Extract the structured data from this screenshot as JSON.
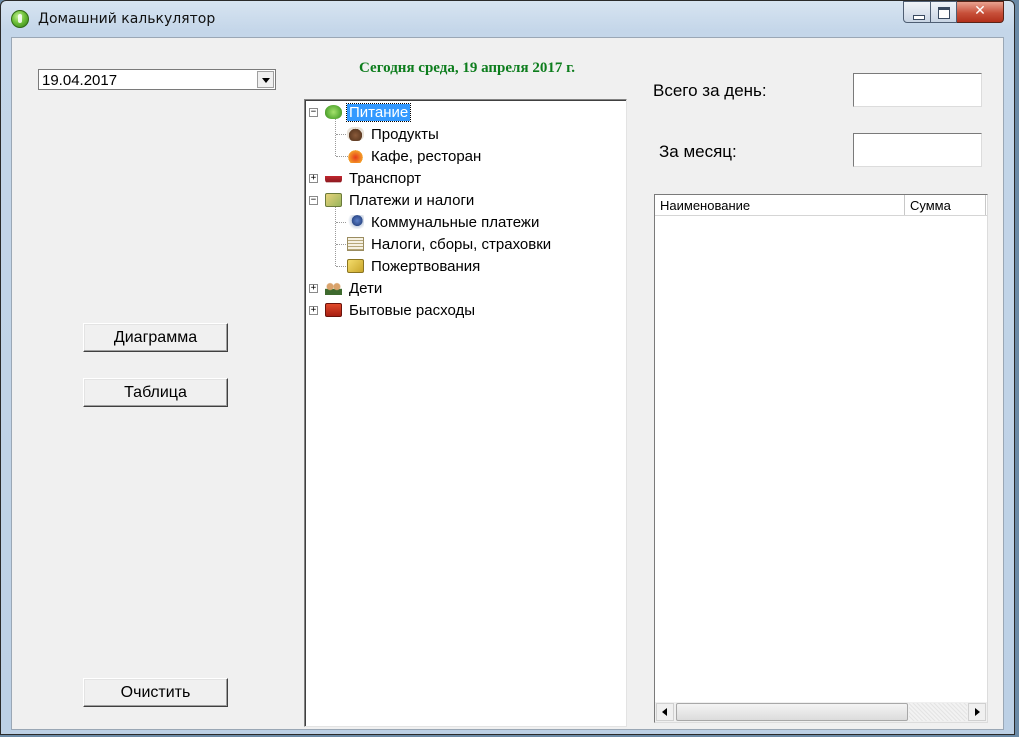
{
  "window": {
    "title": "Домашний калькулятор",
    "close_glyph": "✕"
  },
  "date_picker": {
    "value": "19.04.2017"
  },
  "today_text": "Сегодня среда, 19 апреля 2017 г.",
  "buttons": {
    "diagram": "Диаграмма",
    "table": "Таблица",
    "clear": "Очистить"
  },
  "tree": {
    "expanded_glyph": "−",
    "collapsed_glyph": "+",
    "nodes": [
      {
        "label": "Питание",
        "icon": "food-icon",
        "expanded": true,
        "selected": true
      },
      {
        "label": "Продукты",
        "icon": "groceries-icon"
      },
      {
        "label": "Кафе, ресторан",
        "icon": "cafe-icon"
      },
      {
        "label": "Транспорт",
        "icon": "car-icon",
        "expanded": false
      },
      {
        "label": "Платежи и налоги",
        "icon": "payments-icon",
        "expanded": true
      },
      {
        "label": "Коммунальные платежи",
        "icon": "utilities-icon"
      },
      {
        "label": "Налоги, сборы, страховки",
        "icon": "taxes-icon"
      },
      {
        "label": "Пожертвования",
        "icon": "donations-icon"
      },
      {
        "label": "Дети",
        "icon": "kids-icon",
        "expanded": false
      },
      {
        "label": "Бытовые расходы",
        "icon": "household-icon",
        "expanded": false
      }
    ]
  },
  "totals": {
    "day_label": "Всего за день:",
    "day_value": "",
    "month_label": "За месяц:",
    "month_value": ""
  },
  "list": {
    "columns": [
      "Наименование",
      "Сумма"
    ],
    "rows": []
  }
}
